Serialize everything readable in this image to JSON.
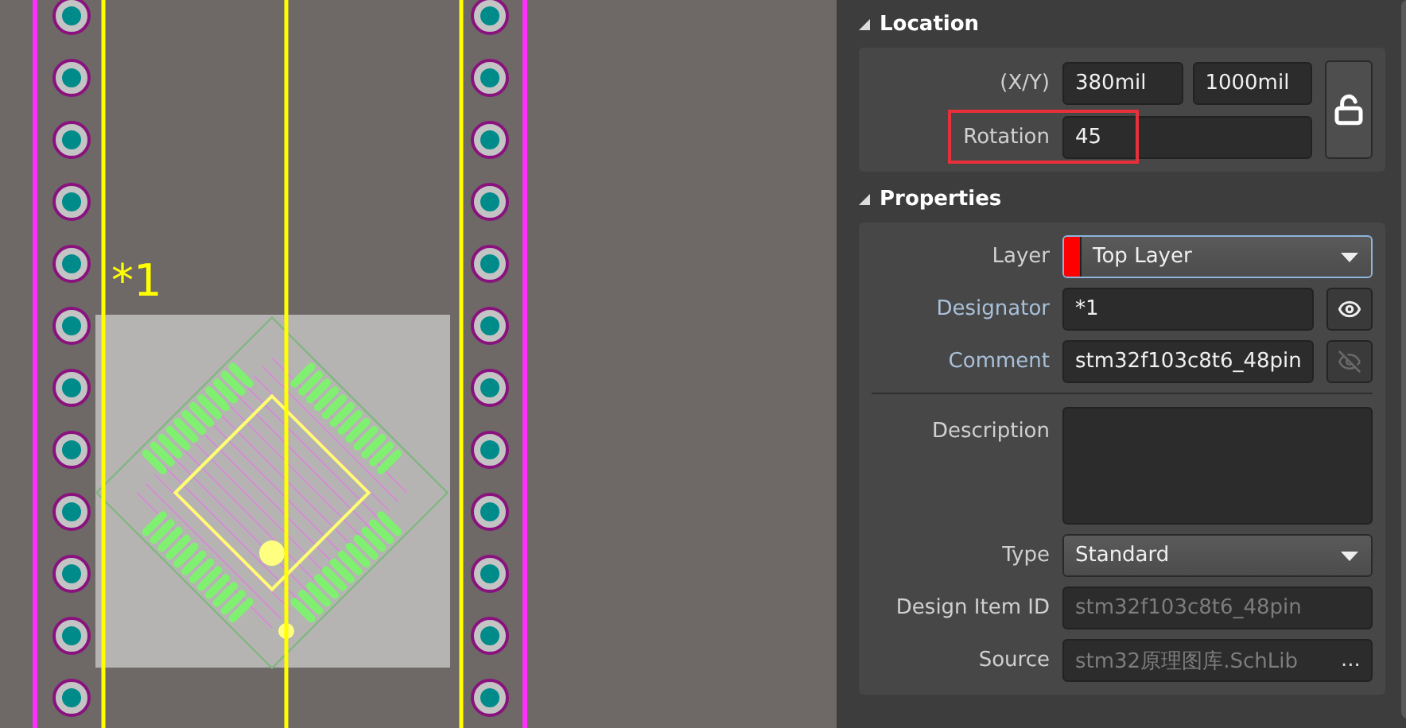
{
  "canvas": {
    "designator_label": "*1"
  },
  "location": {
    "title": "Location",
    "expanded": true,
    "xy_label": "(X/Y)",
    "x": "380mil",
    "y": "1000mil",
    "rotation_label": "Rotation",
    "rotation": "45",
    "rotation_highlighted": true,
    "locked": false
  },
  "properties": {
    "title": "Properties",
    "expanded": true,
    "layer": {
      "label": "Layer",
      "value": "Top Layer",
      "color": "#ff0000"
    },
    "designator": {
      "label": "Designator",
      "value": "*1",
      "linked": true,
      "visible": true
    },
    "comment": {
      "label": "Comment",
      "value": "stm32f103c8t6_48pin",
      "linked": true,
      "visible": false
    },
    "description": {
      "label": "Description"
    },
    "type": {
      "label": "Type",
      "value": "Standard"
    },
    "design_item_id": {
      "label": "Design Item ID",
      "value": "stm32f103c8t6_48pin",
      "disabled": true
    },
    "source": {
      "label": "Source",
      "value": "stm32原理图库.SchLib",
      "disabled": true,
      "button": "..."
    }
  }
}
